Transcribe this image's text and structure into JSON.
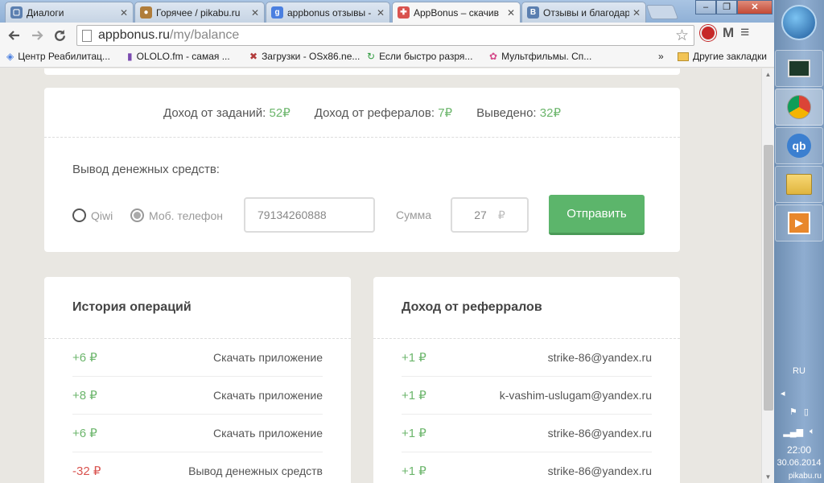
{
  "browser": {
    "tabs": [
      {
        "title": "Диалоги",
        "icon": "vk-icon",
        "color": "#5b7fb0",
        "active": false
      },
      {
        "title": "Горячее / pikabu.ru",
        "icon": "pikabu-icon",
        "color": "#b07d3b",
        "active": false
      },
      {
        "title": "appbonus отзывы -",
        "icon": "google-icon",
        "color": "#4a7fe0",
        "active": false
      },
      {
        "title": "AppBonus – скачив",
        "icon": "appbonus-icon",
        "color": "#d9534f",
        "active": true
      },
      {
        "title": "Отзывы и благодар",
        "icon": "vk-icon",
        "color": "#5b7fb0",
        "active": false
      }
    ],
    "url_host": "appbonus.ru",
    "url_path": "/my/balance",
    "bookmarks": [
      {
        "label": "Центр Реабилитац...",
        "icon": "location-icon"
      },
      {
        "label": "OLOLO.fm - самая ...",
        "icon": "ololo-icon"
      },
      {
        "label": "Загрузки - OSx86.ne...",
        "icon": "osx86-icon"
      },
      {
        "label": "Если быстро разря...",
        "icon": "refresh-icon"
      },
      {
        "label": "Мультфильмы. Сп...",
        "icon": "film-icon"
      }
    ],
    "bookmarks_overflow": "»",
    "other_bookmarks": "Другие закладки"
  },
  "income": {
    "tasks_label": "Доход от заданий:",
    "tasks_value": "52",
    "refs_label": "Доход от рефералов:",
    "refs_value": "7",
    "withdrawn_label": "Выведено:",
    "withdrawn_value": "32",
    "currency": "₽"
  },
  "withdraw": {
    "title": "Вывод денежных средств:",
    "option_qiwi": "Qiwi",
    "option_phone": "Моб. телефон",
    "phone_value": "79134260888",
    "sum_label": "Сумма",
    "sum_value": "27",
    "currency": "₽",
    "submit": "Отправить"
  },
  "history": {
    "title": "История операций",
    "rows": [
      {
        "amount": "+6 ₽",
        "desc": "Скачать приложение"
      },
      {
        "amount": "+8 ₽",
        "desc": "Скачать приложение"
      },
      {
        "amount": "+6 ₽",
        "desc": "Скачать приложение"
      },
      {
        "amount": "-32 ₽",
        "desc": "Вывод денежных средств"
      }
    ]
  },
  "referrals": {
    "title": "Доход от реферралов",
    "rows": [
      {
        "amount": "+1 ₽",
        "email": "strike-86@yandex.ru"
      },
      {
        "amount": "+1 ₽",
        "email": "k-vashim-uslugam@yandex.ru"
      },
      {
        "amount": "+1 ₽",
        "email": "strike-86@yandex.ru"
      },
      {
        "amount": "+1 ₽",
        "email": "strike-86@yandex.ru"
      }
    ]
  },
  "taskbar": {
    "lang": "RU",
    "time": "22:00",
    "date": "30.06.2014",
    "watermark": "pikabu.ru"
  }
}
